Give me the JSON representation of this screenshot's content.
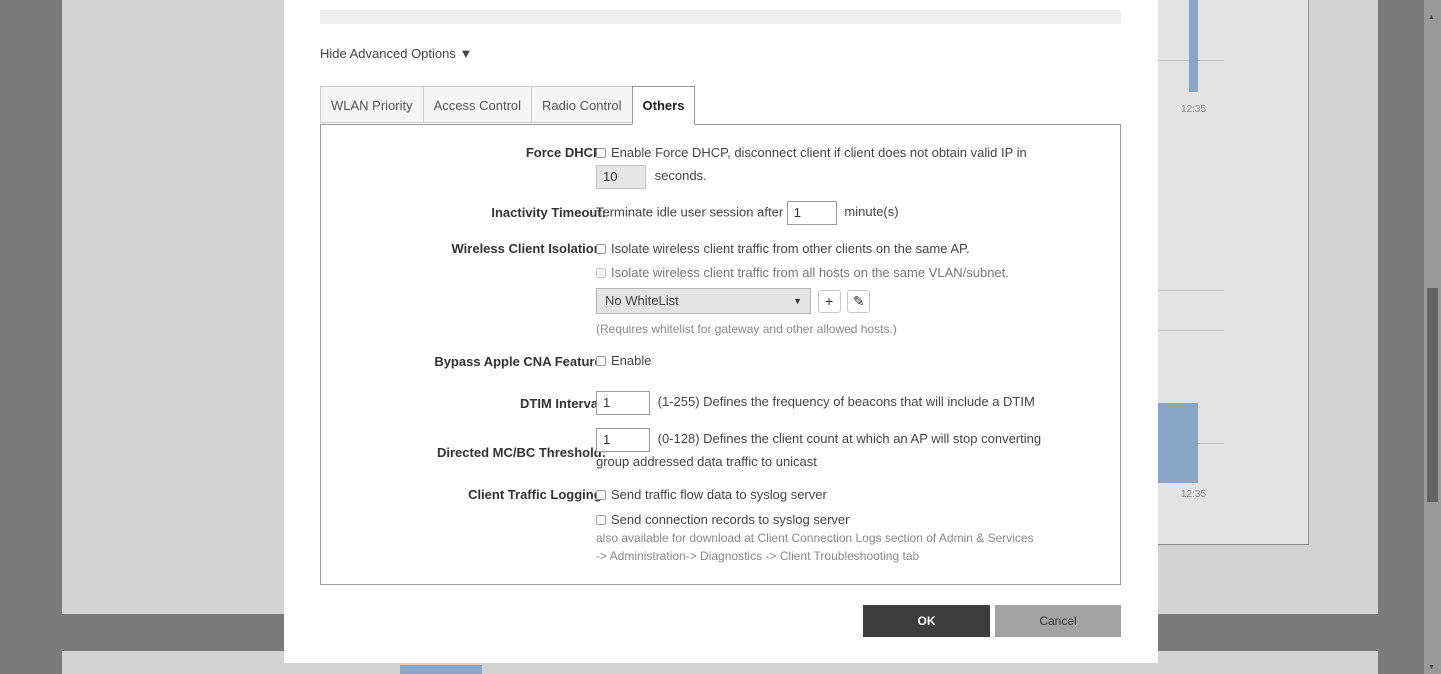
{
  "background": {
    "chart_time_label_1": "12:35",
    "chart_time_label_2": "12:35"
  },
  "modal": {
    "advanced_toggle": "Hide Advanced Options ▼",
    "tabs": [
      {
        "label": "WLAN Priority",
        "active": false
      },
      {
        "label": "Access Control",
        "active": false
      },
      {
        "label": "Radio Control",
        "active": false
      },
      {
        "label": "Others",
        "active": true
      }
    ],
    "force_dhcp": {
      "label": "Force DHCP:",
      "checkbox_text": "Enable Force DHCP, disconnect client if client does not obtain valid IP in",
      "seconds_value": "10",
      "seconds_suffix": "seconds."
    },
    "inactivity_timeout": {
      "label": "Inactivity Timeout:",
      "prefix": "Terminate idle user session after",
      "value": "1",
      "suffix": "minute(s)"
    },
    "wireless_client_isolation": {
      "label": "Wireless Client Isolation:",
      "option1": "Isolate wireless client traffic from other clients on the same AP.",
      "option2": "Isolate wireless client traffic from all hosts on the same VLAN/subnet.",
      "whitelist_selected": "No WhiteList",
      "add_icon": "+",
      "edit_icon": "pencil-icon",
      "hint": "(Requires whitelist for gateway and other allowed hosts.)"
    },
    "bypass_cna": {
      "label": "Bypass Apple CNA Feature:",
      "checkbox_text": "Enable"
    },
    "dtim_interval": {
      "label": "DTIM Interval:",
      "value": "1",
      "description": "(1-255) Defines the frequency of beacons that will include a DTIM"
    },
    "directed_threshold": {
      "label": "Directed MC/BC Threshold:",
      "value": "1",
      "description_line1": "(0-128) Defines the client count at which an AP will stop converting",
      "description_line2": "group addressed data traffic to unicast"
    },
    "client_traffic_logging": {
      "label": "Client Traffic Logging:",
      "option1": "Send traffic flow data to syslog server",
      "option2": "Send connection records to syslog server",
      "note_line1": "also available for download at Client Connection Logs section of Admin & Services",
      "note_line2": "-> Administration-> Diagnostics -> Client Troubleshooting tab"
    },
    "ok_label": "OK",
    "cancel_label": "Cancel"
  }
}
